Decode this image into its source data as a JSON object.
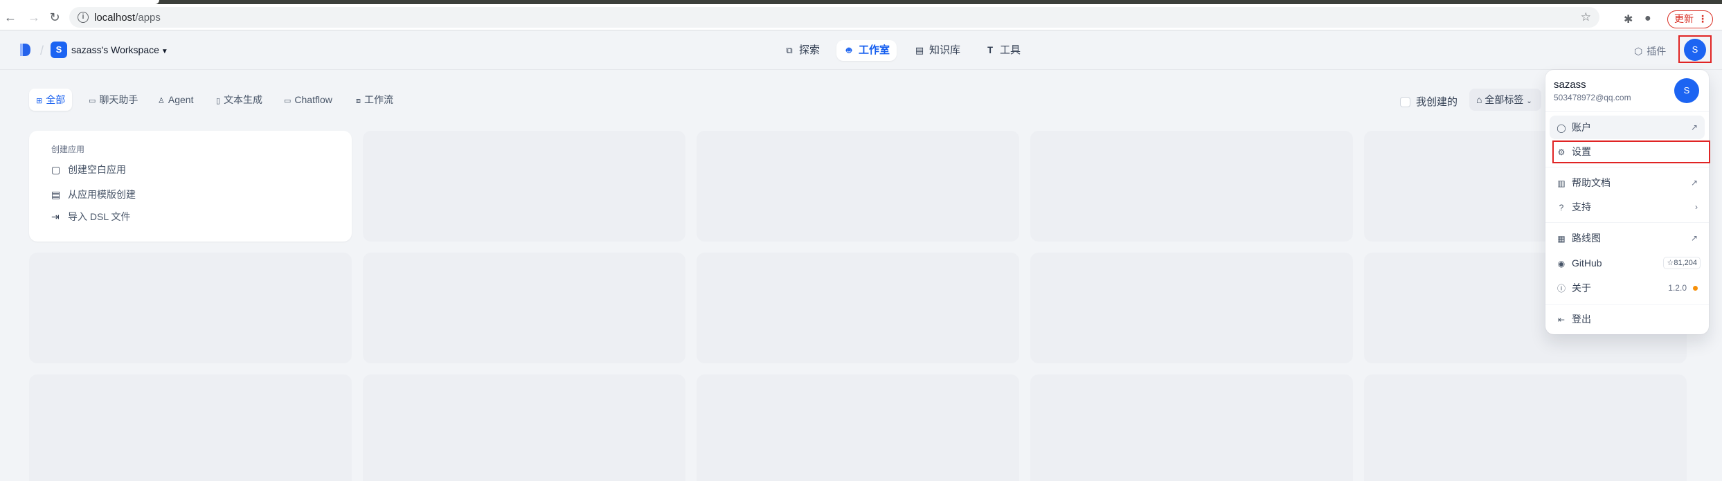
{
  "browser": {
    "url_host": "localhost",
    "url_path": "/apps",
    "update_label": "更新"
  },
  "header": {
    "workspace_initial": "S",
    "workspace_name": "sazass's Workspace",
    "nav": [
      {
        "label": "探索",
        "icon": "compass-icon"
      },
      {
        "label": "工作室",
        "icon": "robot-icon",
        "active": true
      },
      {
        "label": "知识库",
        "icon": "book-icon"
      },
      {
        "label": "工具",
        "icon": "hammer-icon"
      }
    ],
    "plugins_label": "插件",
    "user_initial": "S"
  },
  "filters": {
    "tabs": [
      "全部",
      "聊天助手",
      "Agent",
      "文本生成",
      "Chatflow",
      "工作流"
    ],
    "active_tab": "全部",
    "mine_label": "我创建的",
    "tags_label": "全部标签"
  },
  "create_card": {
    "title": "创建应用",
    "items": [
      "创建空白应用",
      "从应用模版创建",
      "导入 DSL 文件"
    ]
  },
  "user_menu": {
    "name": "sazass",
    "email": "503478972@qq.com",
    "initial": "S",
    "items": {
      "account": "账户",
      "settings": "设置",
      "docs": "帮助文档",
      "support": "支持",
      "roadmap": "路线图",
      "github": "GitHub",
      "github_stars": "81,204",
      "about": "关于",
      "version": "1.2.0",
      "logout": "登出"
    }
  },
  "colors": {
    "accent": "#155eef",
    "avatar": "#1c64f2",
    "highlight_border": "#e02424",
    "background": "#f2f4f7"
  }
}
